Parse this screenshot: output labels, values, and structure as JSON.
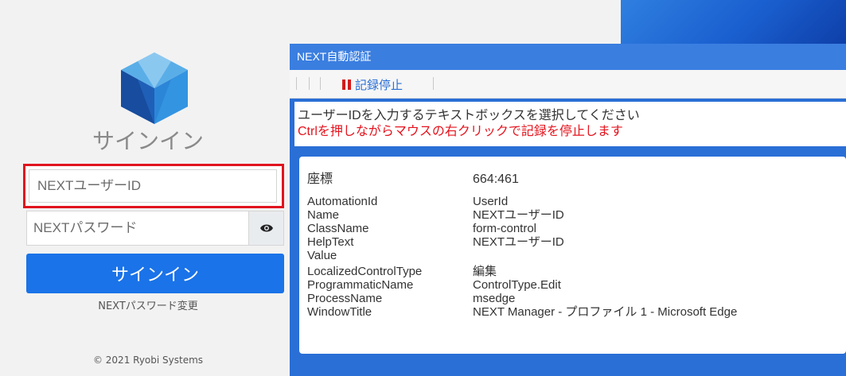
{
  "signin": {
    "title": "サインイン",
    "userid_placeholder": "NEXTユーザーID",
    "password_placeholder": "NEXTパスワード",
    "signin_button": "サインイン",
    "password_change_link": "NEXTパスワード変更",
    "copyright": "© 2021 Ryobi Systems"
  },
  "icons": {
    "logo": "cube-logo-icon",
    "eye": "eye-icon",
    "pause": "pause-icon"
  },
  "colors": {
    "accent_blue": "#1a73e8",
    "highlight_red": "#e0141e",
    "dialog_blue": "#2a6fd6"
  },
  "dialog": {
    "title": "NEXT自動認証",
    "stop_record_label": "記録停止",
    "instruction_line1": "ユーザーIDを入力するテキストボックスを選択してください",
    "instruction_line2": "Ctrlを押しながらマウスの右クリックで記録を停止します",
    "properties": [
      {
        "key": "座標",
        "value": "664:461"
      },
      {
        "key": "AutomationId",
        "value": "UserId"
      },
      {
        "key": "Name",
        "value": "NEXTユーザーID"
      },
      {
        "key": "ClassName",
        "value": "form-control"
      },
      {
        "key": "HelpText",
        "value": "NEXTユーザーID"
      },
      {
        "key": "Value",
        "value": ""
      },
      {
        "key": "LocalizedControlType",
        "value": "編集"
      },
      {
        "key": "ProgrammaticName",
        "value": "ControlType.Edit"
      },
      {
        "key": "ProcessName",
        "value": "msedge"
      },
      {
        "key": "WindowTitle",
        "value": "NEXT Manager - プロファイル 1 - Microsoft Edge"
      }
    ]
  }
}
